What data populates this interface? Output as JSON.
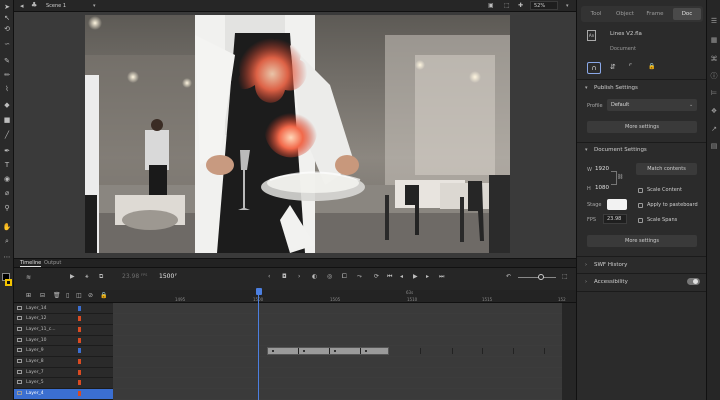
{
  "stage": {
    "scene_label": "Scene 1",
    "zoom": "52%"
  },
  "timeline": {
    "tabs": [
      "Timeline",
      "Output"
    ],
    "fps": "23.98",
    "fps_unit": "FPS",
    "current_frame": "1500",
    "frame_suffix": "F",
    "ruler": [
      "1495",
      "1500",
      "1505",
      "1510",
      "1515",
      "152"
    ],
    "time_marker": "63s",
    "layers": [
      {
        "name": "Layer_14",
        "color": "#3b6fd1"
      },
      {
        "name": "Layer_12",
        "color": "#d94b22"
      },
      {
        "name": "Layer_11_c...",
        "color": "#d94b22"
      },
      {
        "name": "Layer_10",
        "color": "#d94b22"
      },
      {
        "name": "Layer_9",
        "color": "#3b6fd1"
      },
      {
        "name": "Layer_8",
        "color": "#d94b22"
      },
      {
        "name": "Layer_7",
        "color": "#d94b22"
      },
      {
        "name": "Layer_5",
        "color": "#d94b22"
      },
      {
        "name": "Layer_4",
        "color": "#d94b22"
      }
    ],
    "selected_layer_index": 8,
    "playhead_position_fraction": 0.325
  },
  "properties": {
    "tabs": [
      "Tool",
      "Object",
      "Frame",
      "Doc"
    ],
    "active_tab": "Doc",
    "doc_name": "Lines V2.fla",
    "doc_type": "Document",
    "publish_settings": {
      "title": "Publish Settings",
      "profile_label": "Profile",
      "profile_value": "Default",
      "more_button": "More settings"
    },
    "document_settings": {
      "title": "Document Settings",
      "w_label": "W",
      "w_value": "1920",
      "h_label": "H",
      "h_value": "1080",
      "match_button": "Match contents",
      "scale_content": "Scale Content",
      "apply_pasteboard": "Apply to pasteboard",
      "scale_spans": "Scale Spans",
      "stage_label": "Stage",
      "fps_label": "FPS",
      "fps_value": "23.98",
      "more_button": "More settings"
    },
    "swf_history": "SWF History",
    "accessibility": "Accessibility"
  },
  "colors": {
    "accent": "#3b6fd1",
    "layer_orange": "#d94b22",
    "selected_row": "#3b6fd1",
    "playhead": "#4c7fe0"
  }
}
